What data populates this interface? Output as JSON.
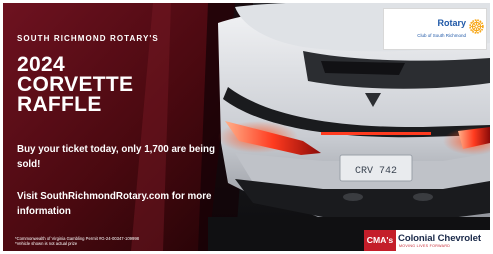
{
  "promo": {
    "org": "SOUTH RICHMOND ROTARY'S",
    "title_lines": [
      "2024",
      "CORVETTE",
      "RAFFLE"
    ],
    "pitch": "Buy your ticket today, only 1,700 are being sold!",
    "visit": "Visit SouthRichmondRotary.com for more information",
    "fine_print": "*Commonwealth of Virginia Gambling Permit #G-24-00347-109998 *Vehicle shown is not actual prize"
  },
  "rotary_logo": {
    "name": "Rotary",
    "subtitle": "Club of South Richmond",
    "icon": "rotary-wheel-icon",
    "color": "#1f58a7"
  },
  "dealer_logo": {
    "badge": "CMA's",
    "name": "Colonial Chevrolet",
    "tagline": "MOVING LIVES FORWARD",
    "badge_color": "#c41e2a"
  },
  "license_plate": "CRV 742",
  "colors": {
    "background": "#5a0d16",
    "text": "#ffffff",
    "taillight": "#ff3b1f"
  }
}
